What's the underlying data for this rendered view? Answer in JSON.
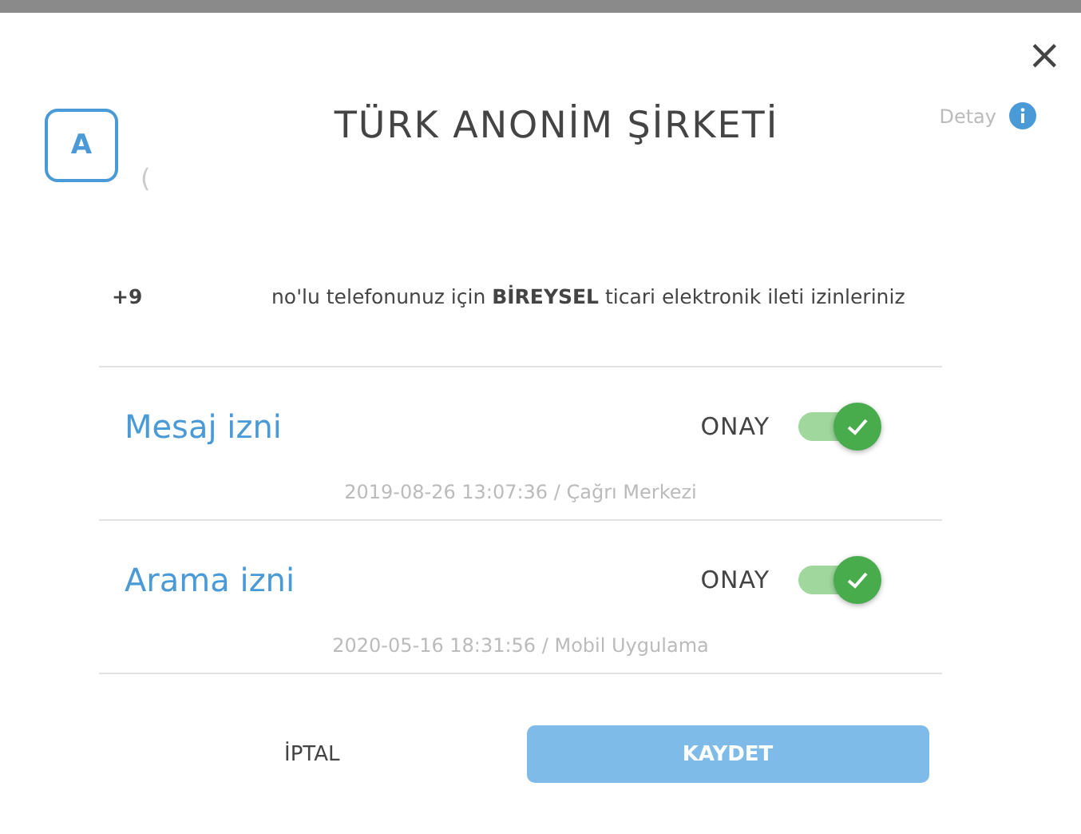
{
  "modal": {
    "avatar": "A",
    "avatar_sub": "(",
    "title": "TÜRK ANONİM ŞİRKETİ",
    "detail_link": "Detay",
    "close": "×"
  },
  "intro": {
    "phone_prefix": "+9",
    "text": "no'lu telefonunuz için **BİREYSEL** ticari elektronik ileti izinleriniz"
  },
  "permissions": [
    {
      "label": "Mesaj izni",
      "status": "ONAY",
      "on": true,
      "meta": "2019-08-26 13:07:36 / Çağrı Merkezi"
    },
    {
      "label": "Arama izni",
      "status": "ONAY",
      "on": true,
      "meta": "2020-05-16 18:31:56 / Mobil Uygulama"
    }
  ],
  "buttons": {
    "cancel": "İPTAL",
    "save": "KAYDET"
  }
}
